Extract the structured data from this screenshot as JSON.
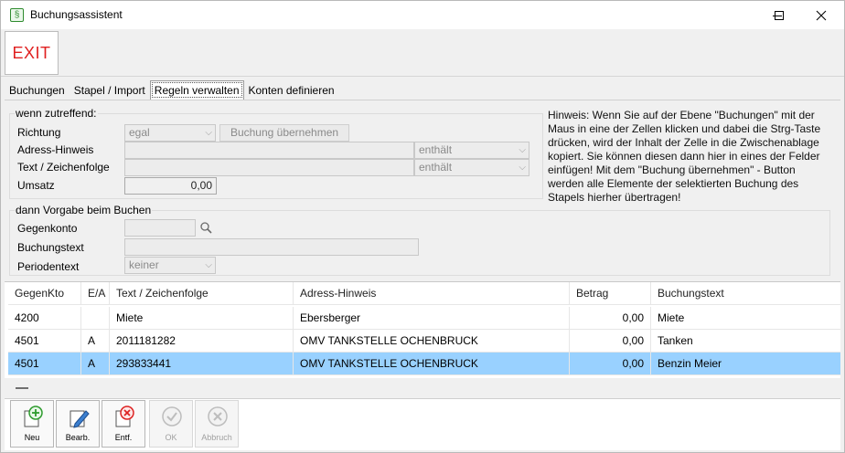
{
  "window": {
    "title": "Buchungsassistent",
    "icon": "app-icon",
    "icon_glyph": "§",
    "controls": [
      "minimize-icon",
      "maximize-icon",
      "close-icon"
    ]
  },
  "exit_button": {
    "label": "EXIT",
    "color": "#e02020"
  },
  "tabs": [
    {
      "label": "Buchungen",
      "active": false
    },
    {
      "label": "Stapel / Import",
      "active": false
    },
    {
      "label": "Regeln verwalten",
      "active": true
    },
    {
      "label": "Konten definieren",
      "active": false
    }
  ],
  "conditions": {
    "group_label": "wenn zutreffend:",
    "richtung_label": "Richtung",
    "richtung_value": "egal",
    "buchung_uebernehmen_label": "Buchung übernehmen",
    "adress_label": "Adress-Hinweis",
    "adress_value": "",
    "adress_mode": "enthält",
    "text_label": "Text / Zeichenfolge",
    "text_value": "",
    "text_mode": "enthält",
    "umsatz_label": "Umsatz",
    "umsatz_value": "0,00"
  },
  "defaults": {
    "group_label": "dann Vorgabe beim Buchen",
    "gegenkonto_label": "Gegenkonto",
    "gegenkonto_value": "",
    "buchungstext_label": "Buchungstext",
    "buchungstext_value": "",
    "periodentext_label": "Periodentext",
    "periodentext_value": "keiner"
  },
  "hint": "Hinweis: Wenn Sie auf der Ebene \"Buchungen\" mit der Maus in eine der Zellen klicken und dabei die Strg-Taste drücken, wird der Inhalt der Zelle in die Zwischenablage kopiert. Sie können diesen dann hier in eines der Felder einfügen! Mit dem \"Buchung übernehmen\" - Button werden alle Elemente der selektierten Buchung des Stapels hierher übertragen!",
  "table": {
    "columns": [
      "GegenKto",
      "E/A",
      "Text / Zeichenfolge",
      "Adress-Hinweis",
      "Betrag",
      "Buchungstext"
    ],
    "rows": [
      {
        "gegenkto": "4200",
        "ea": "",
        "text": "Miete",
        "adresse": "Ebersberger",
        "betrag": "0,00",
        "buchungstext": "Miete",
        "selected": false
      },
      {
        "gegenkto": "4501",
        "ea": "A",
        "text": "2011181282",
        "adresse": "OMV TANKSTELLE OCHENBRUCK",
        "betrag": "0,00",
        "buchungstext": "Tanken",
        "selected": false
      },
      {
        "gegenkto": "4501",
        "ea": "A",
        "text": "293833441",
        "adresse": "OMV TANKSTELLE OCHENBRUCK",
        "betrag": "0,00",
        "buchungstext": "Benzin Meier",
        "selected": true
      }
    ],
    "selected_color": "#99d1ff"
  },
  "toolbar": {
    "neu": "Neu",
    "bearb": "Bearb.",
    "entf": "Entf.",
    "ok": "OK",
    "abbruch": "Abbruch"
  }
}
